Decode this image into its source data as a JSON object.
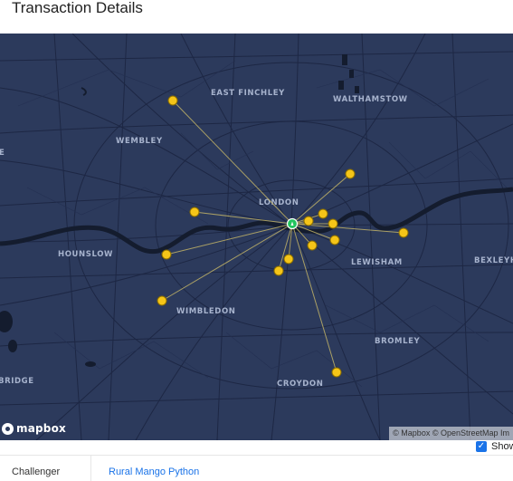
{
  "page": {
    "title": "Transaction Details"
  },
  "map": {
    "labels": {
      "east_finchley": "EAST FINCHLEY",
      "walthamstow": "WALTHAMSTOW",
      "wembley": "WEMBLEY",
      "london": "LONDON",
      "hounslow": "HOUNSLOW",
      "lewisham": "LEWISHAM",
      "bexleyheath": "BEXLEYHE",
      "wimbledon": "WIMBLEDON",
      "bromley": "BROMLEY",
      "croydon": "CROYDON",
      "bridge": "BRIDGE"
    },
    "logo_text": "mapbox",
    "attribution": "© Mapbox © OpenStreetMap Im",
    "center_marker_color": "#22c55e",
    "point_color": "#f5c518",
    "line_color": "#c9b968",
    "water_color": "#141c2e",
    "background_color": "#2c3a5c"
  },
  "controls": {
    "show_label": "Show",
    "show_checked": true,
    "accent_color": "#1a73e8"
  },
  "details": [
    {
      "key": "Challenger",
      "value": "Rural Mango Python"
    }
  ]
}
